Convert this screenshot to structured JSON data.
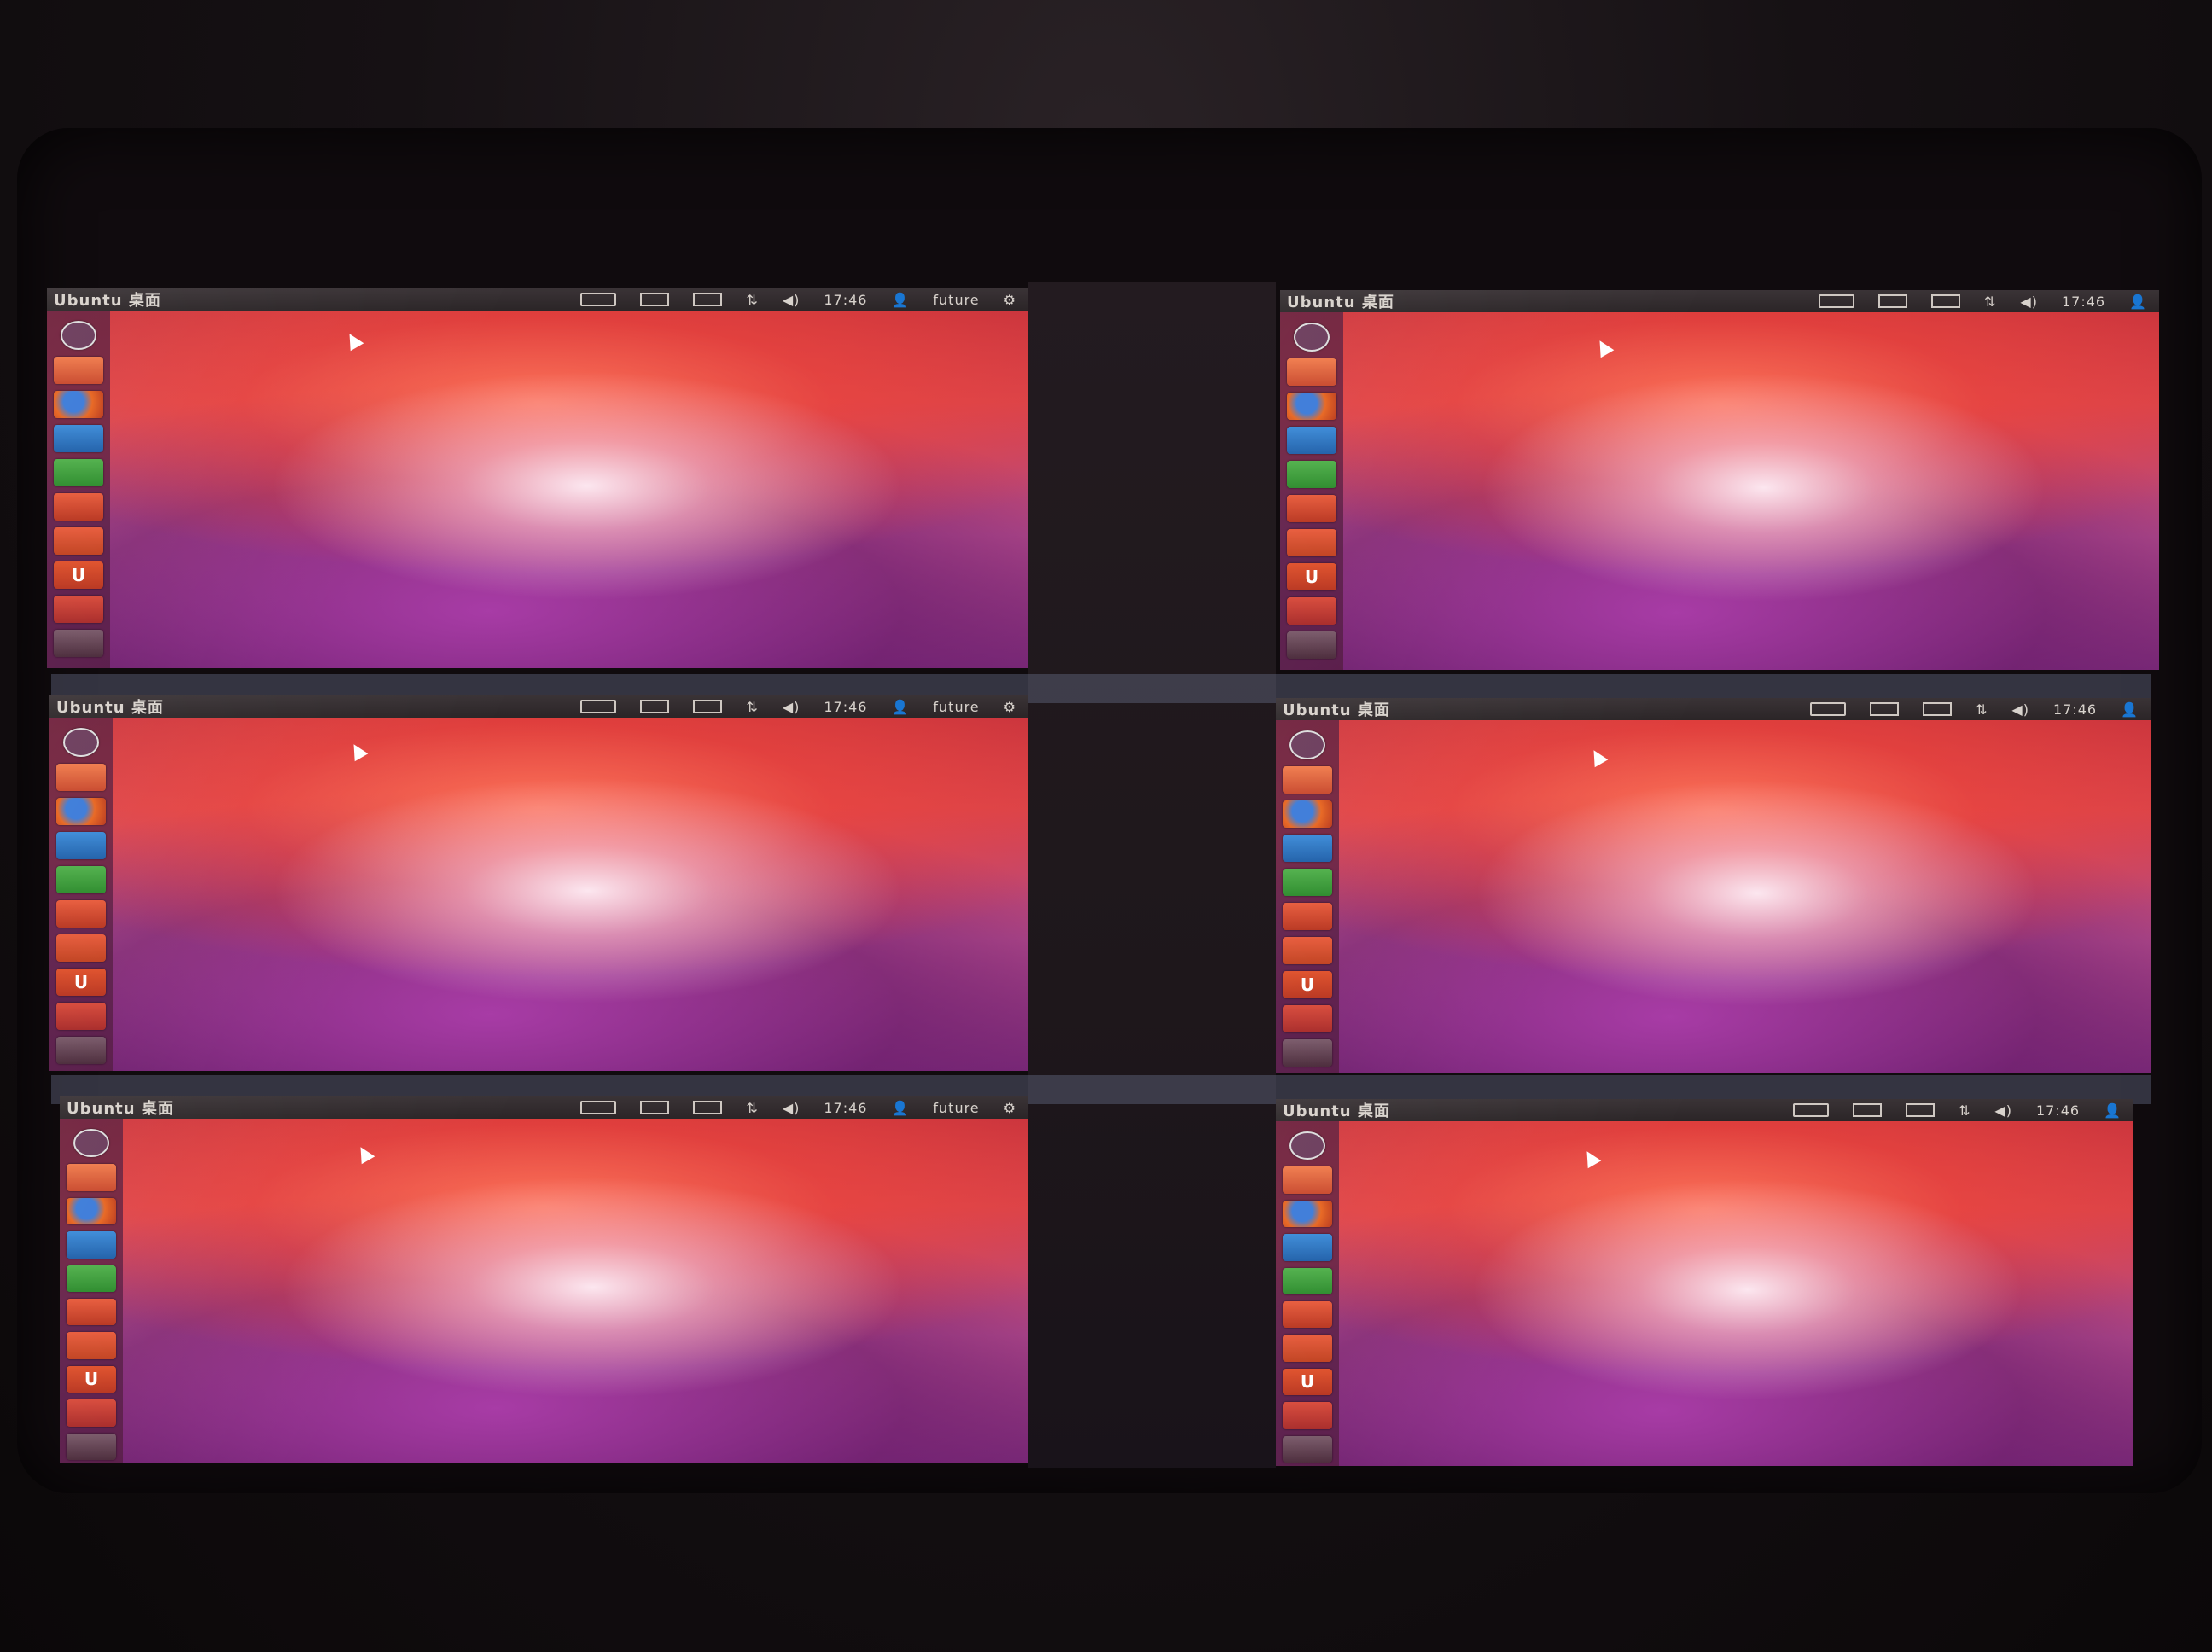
{
  "screens": [
    {
      "id": "top-left",
      "panel": {
        "title": "Ubuntu 桌面",
        "clock": "17:46",
        "user": "future"
      }
    },
    {
      "id": "top-right",
      "panel": {
        "title": "Ubuntu 桌面",
        "clock": "17:46",
        "user": ""
      }
    },
    {
      "id": "middle-left",
      "panel": {
        "title": "Ubuntu 桌面",
        "clock": "17:46",
        "user": "future"
      }
    },
    {
      "id": "middle-right",
      "panel": {
        "title": "Ubuntu 桌面",
        "clock": "17:46",
        "user": ""
      }
    },
    {
      "id": "bottom-left",
      "panel": {
        "title": "Ubuntu 桌面",
        "clock": "17:46",
        "user": "future"
      }
    },
    {
      "id": "bottom-right",
      "panel": {
        "title": "Ubuntu 桌面",
        "clock": "17:46",
        "user": ""
      }
    }
  ],
  "launcher_items": [
    {
      "icon": "dash-home-icon"
    },
    {
      "icon": "files-icon"
    },
    {
      "icon": "firefox-icon"
    },
    {
      "icon": "libreoffice-writer-icon"
    },
    {
      "icon": "libreoffice-calc-icon"
    },
    {
      "icon": "libreoffice-impress-icon"
    },
    {
      "icon": "software-center-icon",
      "glyph": ""
    },
    {
      "icon": "ubuntu-one-icon",
      "glyph": "U"
    },
    {
      "icon": "system-settings-icon"
    },
    {
      "icon": "workspace-switcher-icon"
    }
  ],
  "colors": {
    "panel_bg": "#2b2527",
    "panel_text": "#d8d2cc",
    "launcher_bg": "#50193c",
    "wallpaper_top": "#c8323a",
    "wallpaper_bottom": "#7a2a78"
  }
}
